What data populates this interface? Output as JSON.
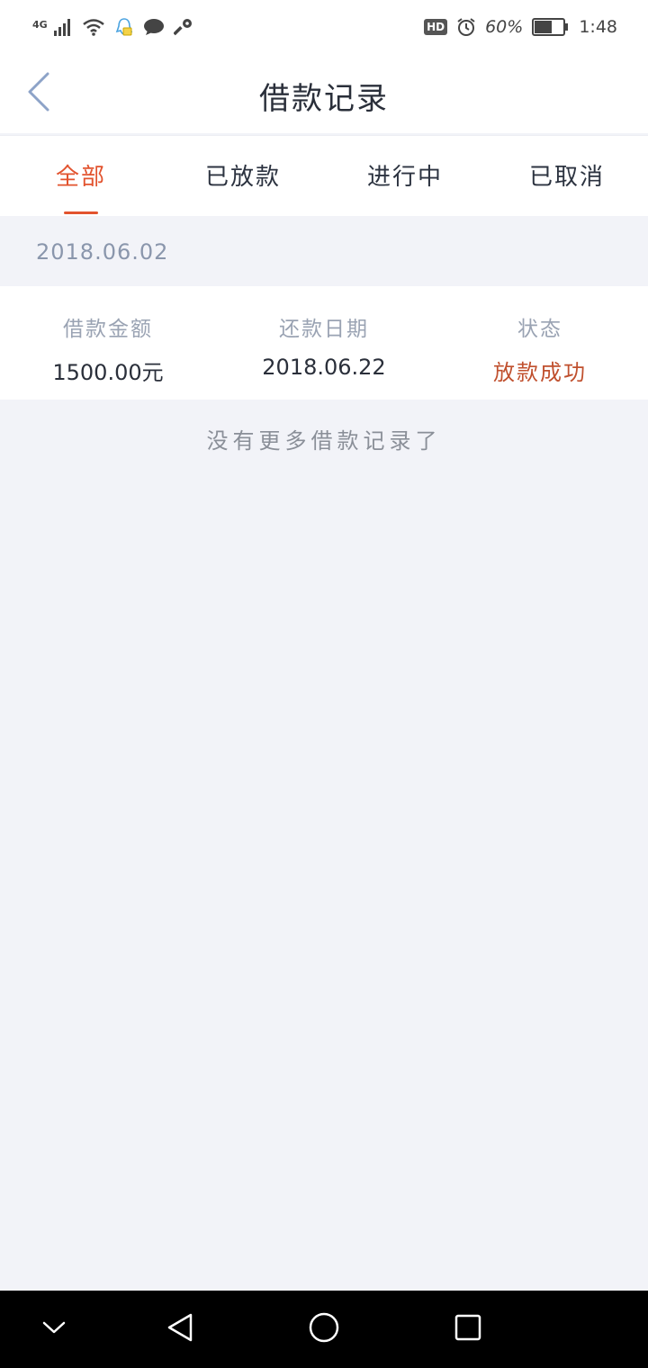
{
  "statusbar": {
    "network": "4G",
    "hd": "HD",
    "battery_percent": "60%",
    "time": "1:48",
    "battery_level": 0.6
  },
  "header": {
    "title": "借款记录"
  },
  "tabs": [
    {
      "label": "全部",
      "active": true
    },
    {
      "label": "已放款",
      "active": false
    },
    {
      "label": "进行中",
      "active": false
    },
    {
      "label": "已取消",
      "active": false
    }
  ],
  "records": [
    {
      "date": "2018.06.02",
      "amount_label": "借款金额",
      "amount": "1500.00元",
      "repay_label": "还款日期",
      "repay_date": "2018.06.22",
      "status_label": "状态",
      "status": "放款成功"
    }
  ],
  "end_message": "没有更多借款记录了",
  "colors": {
    "accent": "#e2532e",
    "status_success": "#c0502e",
    "background": "#f2f3f8"
  }
}
